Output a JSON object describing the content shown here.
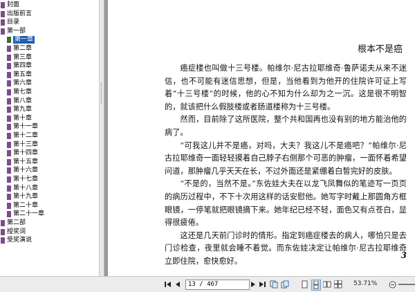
{
  "toc": [
    {
      "label": "封面",
      "level": 0,
      "icon": "bookmark-icon"
    },
    {
      "label": "出版前言",
      "level": 0,
      "icon": "bookmark-icon"
    },
    {
      "label": "目录",
      "level": 0,
      "icon": "bookmark-icon"
    },
    {
      "label": "第一部",
      "level": 0,
      "icon": "bookmark-icon"
    },
    {
      "label": "第一章",
      "level": 1,
      "icon": "bookmark-icon",
      "selected": true
    },
    {
      "label": "第二章",
      "level": 1,
      "icon": "bookmark-icon"
    },
    {
      "label": "第三章",
      "level": 1,
      "icon": "bookmark-icon"
    },
    {
      "label": "第四章",
      "level": 1,
      "icon": "bookmark-icon"
    },
    {
      "label": "第五章",
      "level": 1,
      "icon": "bookmark-icon"
    },
    {
      "label": "第六章",
      "level": 1,
      "icon": "bookmark-icon"
    },
    {
      "label": "第七章",
      "level": 1,
      "icon": "bookmark-icon"
    },
    {
      "label": "第八章",
      "level": 1,
      "icon": "bookmark-icon"
    },
    {
      "label": "第九章",
      "level": 1,
      "icon": "bookmark-icon"
    },
    {
      "label": "第十章",
      "level": 1,
      "icon": "bookmark-icon"
    },
    {
      "label": "第十一章",
      "level": 1,
      "icon": "bookmark-icon"
    },
    {
      "label": "第十二章",
      "level": 1,
      "icon": "bookmark-icon"
    },
    {
      "label": "第十三章",
      "level": 1,
      "icon": "bookmark-icon"
    },
    {
      "label": "第十四章",
      "level": 1,
      "icon": "bookmark-icon"
    },
    {
      "label": "第十五章",
      "level": 1,
      "icon": "bookmark-icon"
    },
    {
      "label": "第十六章",
      "level": 1,
      "icon": "bookmark-icon"
    },
    {
      "label": "第十七章",
      "level": 1,
      "icon": "bookmark-icon"
    },
    {
      "label": "第十八章",
      "level": 1,
      "icon": "bookmark-icon"
    },
    {
      "label": "第十九章",
      "level": 1,
      "icon": "bookmark-icon"
    },
    {
      "label": "第二十章",
      "level": 1,
      "icon": "bookmark-icon"
    },
    {
      "label": "第二十一章",
      "level": 1,
      "icon": "bookmark-icon"
    },
    {
      "label": "第二部",
      "level": 0,
      "icon": "bookmark-icon"
    },
    {
      "label": "授奖词",
      "level": 0,
      "icon": "bookmark-icon"
    },
    {
      "label": "受奖演说",
      "level": 0,
      "icon": "bookmark-icon"
    }
  ],
  "page": {
    "running_head": "根本不是癌",
    "paragraphs": [
      "癌症楼也叫做十三号楼。帕维尔·尼古拉耶维奇·鲁萨诺夫从来不迷信，也不可能有迷信思想，但是，当他看到为他开的住院许可证上写着“十三号楼”的时候，他的心不知为什么却为之一沉。这是很不明智的，就该把什么假肢楼或者肠道楼称为十三号楼。",
      "然而，目前除了这所医院，整个共和国再也没有别的地方能治他的病了。",
      "“可我这儿并不是癌，对吗，大夫？我这儿不是癌吧？”帕维尔·尼古拉耶维奇一面轻轻摸着自己脖子右侧那个可恶的肿瘤，一面怀着希望问道，那肿瘤几乎天天在长，不过外面还是紧绷着白皙完好的皮肤。",
      "“不是的，当然不是。”东佐娃大夫在以龙飞凤舞似的笔迹写一页页的病历过程中，不下十次用这样的话安慰他。她写字时戴上那圆角方框眼镜，一停笔就把眼镜摘下来。她年纪已经不轻，面色又有点苍白，显得很疲倦。",
      "这还是几天前门诊时的情形。指定到癌症楼去的病人，哪怕只是去门诊检查，夜里就会睡不着觉。而东佐娃决定让帕维尔·尼古拉耶维奇立即住院，愈快愈好。"
    ],
    "folio": "3"
  },
  "toolbar": {
    "page_field": "13 / 467",
    "zoom": "53.71%",
    "icons": [
      "first-page-icon",
      "prev-page-icon",
      "next-page-icon",
      "last-page-icon",
      "back-icon",
      "forward-icon",
      "single-page-icon",
      "continuous-icon",
      "facing-icon",
      "zoom-out-icon"
    ]
  }
}
